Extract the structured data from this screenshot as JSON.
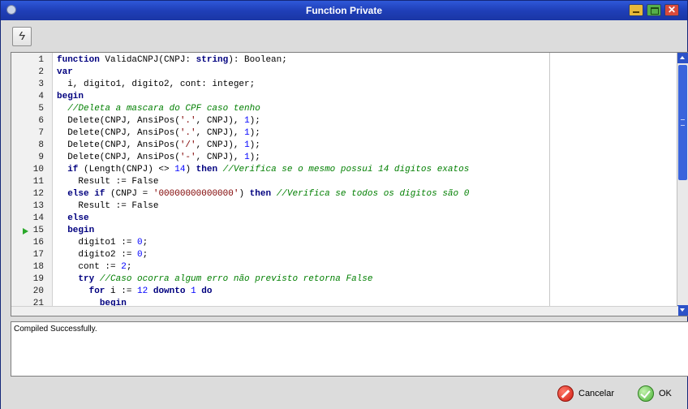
{
  "window": {
    "title": "Function Private",
    "close_glyph": "✕"
  },
  "toolbar": {
    "compile_icon": "lightning-icon",
    "compile_glyph": "ϟ"
  },
  "editor": {
    "breakpoint_line": "15",
    "lines": [
      {
        "n": "1",
        "tokens": [
          [
            "kw",
            "function"
          ],
          [
            "tx",
            " ValidaCNPJ(CNPJ: "
          ],
          [
            "kw",
            "string"
          ],
          [
            "tx",
            "): Boolean;"
          ]
        ]
      },
      {
        "n": "2",
        "tokens": [
          [
            "kw",
            "var"
          ]
        ]
      },
      {
        "n": "3",
        "tokens": [
          [
            "tx",
            "  i, digito1, digito2, cont: integer;"
          ]
        ]
      },
      {
        "n": "4",
        "tokens": [
          [
            "kw",
            "begin"
          ]
        ]
      },
      {
        "n": "5",
        "tokens": [
          [
            "cm",
            "  //Deleta a mascara do CPF caso tenho"
          ]
        ]
      },
      {
        "n": "6",
        "tokens": [
          [
            "tx",
            "  Delete(CNPJ, AnsiPos("
          ],
          [
            "st",
            "'.'"
          ],
          [
            "tx",
            ", CNPJ), "
          ],
          [
            "nm",
            "1"
          ],
          [
            "tx",
            ");"
          ]
        ]
      },
      {
        "n": "7",
        "tokens": [
          [
            "tx",
            "  Delete(CNPJ, AnsiPos("
          ],
          [
            "st",
            "'.'"
          ],
          [
            "tx",
            ", CNPJ), "
          ],
          [
            "nm",
            "1"
          ],
          [
            "tx",
            ");"
          ]
        ]
      },
      {
        "n": "8",
        "tokens": [
          [
            "tx",
            "  Delete(CNPJ, AnsiPos("
          ],
          [
            "st",
            "'/'"
          ],
          [
            "tx",
            ", CNPJ), "
          ],
          [
            "nm",
            "1"
          ],
          [
            "tx",
            ");"
          ]
        ]
      },
      {
        "n": "9",
        "tokens": [
          [
            "tx",
            "  Delete(CNPJ, AnsiPos("
          ],
          [
            "st",
            "'-'"
          ],
          [
            "tx",
            ", CNPJ), "
          ],
          [
            "nm",
            "1"
          ],
          [
            "tx",
            ");"
          ]
        ]
      },
      {
        "n": "10",
        "tokens": [
          [
            "tx",
            "  "
          ],
          [
            "kw",
            "if"
          ],
          [
            "tx",
            " (Length(CNPJ) <> "
          ],
          [
            "nm",
            "14"
          ],
          [
            "tx",
            ") "
          ],
          [
            "kw",
            "then"
          ],
          [
            "tx",
            " "
          ],
          [
            "cm",
            "//Verifica se o mesmo possui 14 digitos exatos"
          ]
        ]
      },
      {
        "n": "11",
        "tokens": [
          [
            "tx",
            "    Result := False"
          ]
        ]
      },
      {
        "n": "12",
        "tokens": [
          [
            "tx",
            "  "
          ],
          [
            "kw",
            "else if"
          ],
          [
            "tx",
            " (CNPJ = "
          ],
          [
            "st",
            "'00000000000000'"
          ],
          [
            "tx",
            ") "
          ],
          [
            "kw",
            "then"
          ],
          [
            "tx",
            " "
          ],
          [
            "cm",
            "//Verifica se todos os digitos são 0"
          ]
        ]
      },
      {
        "n": "13",
        "tokens": [
          [
            "tx",
            "    Result := False"
          ]
        ]
      },
      {
        "n": "14",
        "tokens": [
          [
            "tx",
            "  "
          ],
          [
            "kw",
            "else"
          ]
        ]
      },
      {
        "n": "15",
        "tokens": [
          [
            "tx",
            "  "
          ],
          [
            "kw",
            "begin"
          ]
        ]
      },
      {
        "n": "16",
        "tokens": [
          [
            "tx",
            "    digito1 := "
          ],
          [
            "nm",
            "0"
          ],
          [
            "tx",
            ";"
          ]
        ]
      },
      {
        "n": "17",
        "tokens": [
          [
            "tx",
            "    digito2 := "
          ],
          [
            "nm",
            "0"
          ],
          [
            "tx",
            ";"
          ]
        ]
      },
      {
        "n": "18",
        "tokens": [
          [
            "tx",
            "    cont := "
          ],
          [
            "nm",
            "2"
          ],
          [
            "tx",
            ";"
          ]
        ]
      },
      {
        "n": "19",
        "tokens": [
          [
            "tx",
            "    "
          ],
          [
            "kw",
            "try"
          ],
          [
            "tx",
            " "
          ],
          [
            "cm",
            "//Caso ocorra algum erro não previsto retorna False"
          ]
        ]
      },
      {
        "n": "20",
        "tokens": [
          [
            "tx",
            "      "
          ],
          [
            "kw",
            "for"
          ],
          [
            "tx",
            " i := "
          ],
          [
            "nm",
            "12"
          ],
          [
            "tx",
            " "
          ],
          [
            "kw",
            "downto"
          ],
          [
            "tx",
            " "
          ],
          [
            "nm",
            "1"
          ],
          [
            "tx",
            " "
          ],
          [
            "kw",
            "do"
          ]
        ]
      },
      {
        "n": "21",
        "tokens": [
          [
            "tx",
            "        "
          ],
          [
            "kw",
            "begin"
          ]
        ]
      }
    ]
  },
  "output": {
    "message": "Compiled Successfully."
  },
  "footer": {
    "cancel_label": "Cancelar",
    "ok_label": "OK"
  }
}
